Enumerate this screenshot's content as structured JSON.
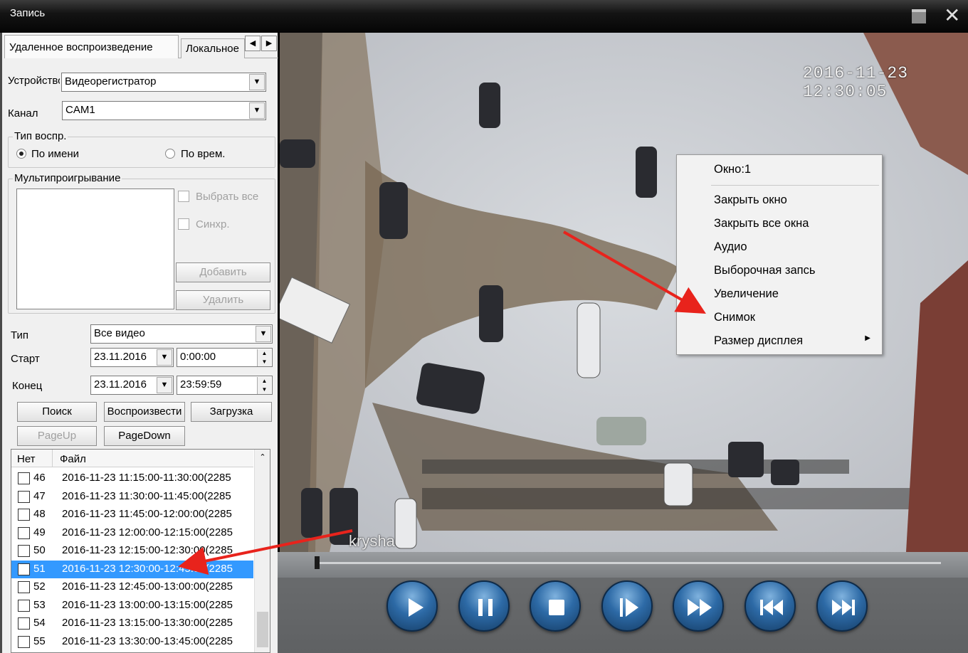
{
  "window": {
    "title": "Запись"
  },
  "tabs": {
    "remote": "Удаленное воспроизведение",
    "local": "Локальное"
  },
  "form": {
    "device_label": "Устройство",
    "device_value": "Видеорегистратор",
    "channel_label": "Канал",
    "channel_value": "CAM1",
    "playback_type_title": "Тип воспр.",
    "by_name": "По имени",
    "by_time": "По врем.",
    "multiplay_title": "Мультипроигрывание",
    "select_all": "Выбрать все",
    "sync": "Синхр.",
    "add": "Добавить",
    "remove": "Удалить",
    "type_label": "Тип",
    "type_value": "Все видео",
    "start_label": "Старт",
    "start_date": "23.11.2016",
    "start_time": "0:00:00",
    "end_label": "Конец",
    "end_date": "23.11.2016",
    "end_time": "23:59:59",
    "search": "Поиск",
    "play": "Воспроизвести",
    "download": "Загрузка",
    "pageup": "PageUp",
    "pagedown": "PageDown"
  },
  "filelist": {
    "col_no": "Нет",
    "col_file": "Файл",
    "rows": [
      {
        "no": "46",
        "file": "2016-11-23 11:15:00-11:30:00(2285"
      },
      {
        "no": "47",
        "file": "2016-11-23 11:30:00-11:45:00(2285"
      },
      {
        "no": "48",
        "file": "2016-11-23 11:45:00-12:00:00(2285"
      },
      {
        "no": "49",
        "file": "2016-11-23 12:00:00-12:15:00(2285"
      },
      {
        "no": "50",
        "file": "2016-11-23 12:15:00-12:30:00(2285"
      },
      {
        "no": "51",
        "file": "2016-11-23 12:30:00-12:45:00(2285"
      },
      {
        "no": "52",
        "file": "2016-11-23 12:45:00-13:00:00(2285"
      },
      {
        "no": "53",
        "file": "2016-11-23 13:00:00-13:15:00(2285"
      },
      {
        "no": "54",
        "file": "2016-11-23 13:15:00-13:30:00(2285"
      },
      {
        "no": "55",
        "file": "2016-11-23 13:30:00-13:45:00(2285"
      }
    ],
    "selected_no": "51"
  },
  "video": {
    "timestamp": "2016-11-23 12:30:05",
    "camera_name": "krysha"
  },
  "context_menu": {
    "header": "Окно:1",
    "items": [
      "Закрыть окно",
      "Закрыть все окна",
      "Аудио",
      "Выборочная запсь",
      "Увеличение",
      "Снимок",
      "Размер дисплея"
    ]
  },
  "playback_controls": [
    "play-icon",
    "pause-icon",
    "stop-icon",
    "step-forward-icon",
    "fast-forward-icon",
    "skip-back-icon",
    "skip-forward-icon"
  ],
  "colors": {
    "selection": "#3399ff",
    "annotation_arrow": "#e8231c"
  }
}
